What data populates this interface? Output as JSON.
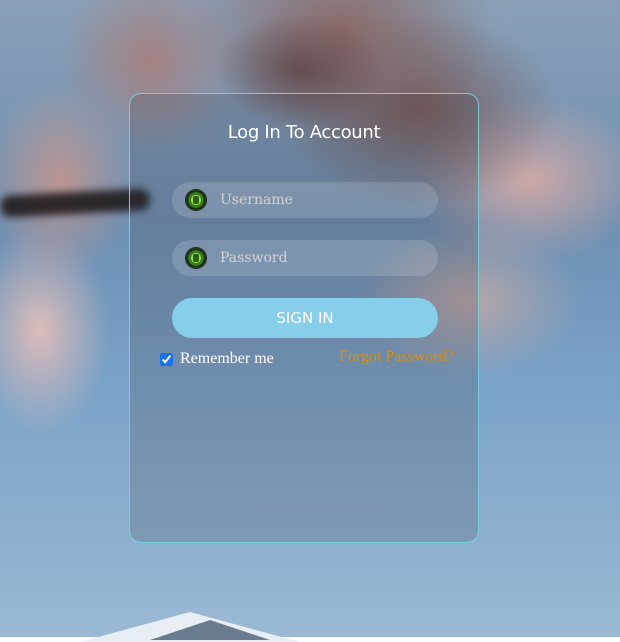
{
  "login": {
    "title": "Log In To Account",
    "username": {
      "placeholder": "Username",
      "value": "",
      "icon": "user-badge-icon"
    },
    "password": {
      "placeholder": "Password",
      "value": "",
      "icon": "lock-badge-icon"
    },
    "signin_label": "SIGN IN",
    "remember_label": "Remember me",
    "remember_checked": true,
    "forgot_label": "Forgot Password?"
  },
  "colors": {
    "card_border": "#6fd0e0",
    "button": "#87ceeb",
    "forgot_link": "#d3901a"
  }
}
